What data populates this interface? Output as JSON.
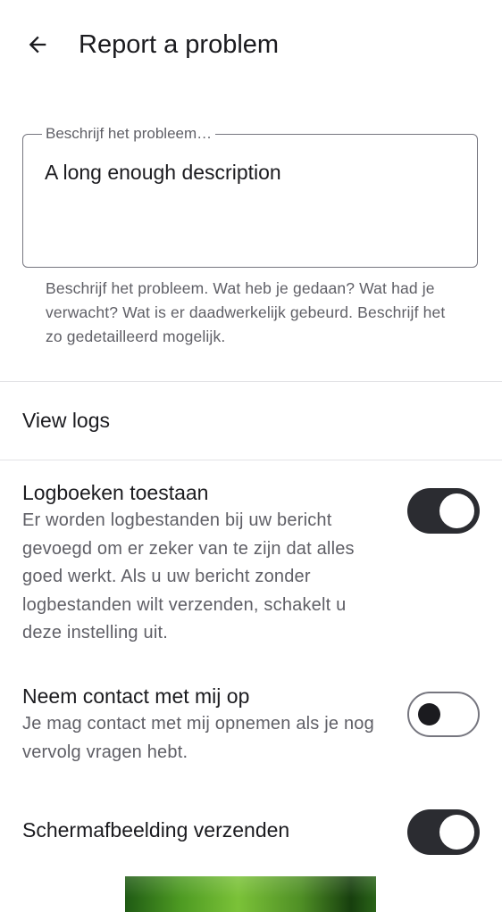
{
  "header": {
    "back_icon": "arrow-left-icon",
    "title": "Report a problem"
  },
  "description": {
    "placeholder": "Beschrijf het probleem…",
    "value": "A long enough description",
    "helper": "Beschrijf het probleem. Wat heb je gedaan? Wat had je verwacht? Wat is er daadwerkelijk gebeurd. Beschrijf het zo gedetailleerd mogelijk."
  },
  "view_logs": {
    "label": "View logs"
  },
  "settings": [
    {
      "title": "Logboeken toestaan",
      "description": "Er worden logbestanden bij uw bericht gevoegd om er zeker van te zijn dat alles goed werkt. Als u uw bericht zonder logbestanden wilt verzenden, schakelt u deze instelling uit.",
      "enabled": true
    },
    {
      "title": "Neem contact met mij op",
      "description": "Je mag contact met mij opnemen als je nog vervolg vragen hebt.",
      "enabled": false
    },
    {
      "title": "Schermafbeelding verzenden",
      "description": "",
      "enabled": true
    }
  ],
  "colors": {
    "switch_on_track": "#2b2c31",
    "switch_off_border": "#76767f",
    "text_primary": "#1b1b1f",
    "text_secondary": "#5f5f66"
  }
}
